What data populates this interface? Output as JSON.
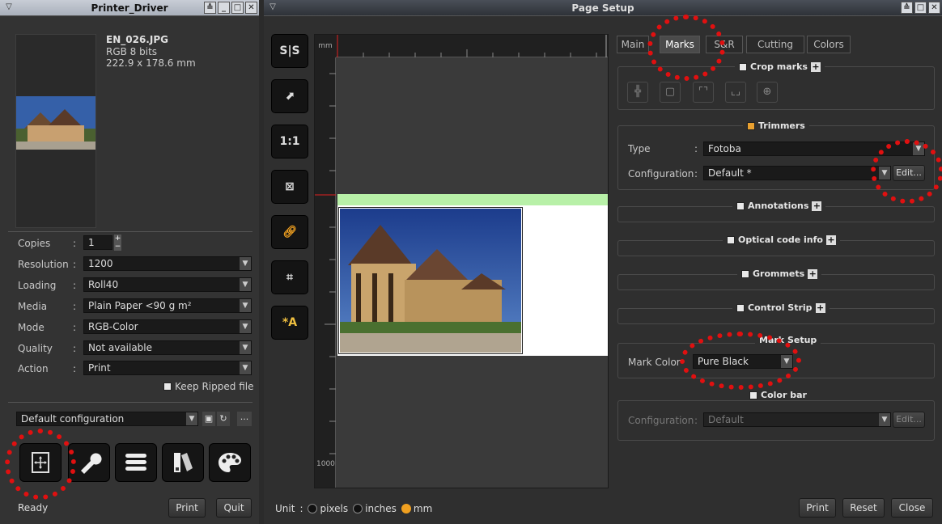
{
  "left_window": {
    "title": "Printer_Driver",
    "file": {
      "name": "EN_026.JPG",
      "mode": "RGB 8 bits",
      "size": "222.9 x 178.6 mm"
    },
    "fields": [
      {
        "label": "Copies",
        "value": "1"
      },
      {
        "label": "Resolution",
        "value": "1200"
      },
      {
        "label": "Loading",
        "value": "Roll40"
      },
      {
        "label": "Media",
        "value": "Plain Paper  <90 g m²"
      },
      {
        "label": "Mode",
        "value": "RGB-Color"
      },
      {
        "label": "Quality",
        "value": "Not available"
      },
      {
        "label": "Action",
        "value": "Print"
      }
    ],
    "keep_ripped": "Keep Ripped file",
    "configuration": "Default configuration",
    "status": "Ready",
    "print_label": "Print",
    "quit_label": "Quit",
    "tools": [
      "page-setup-icon",
      "wrench-icon",
      "list-icon",
      "swatch-icon",
      "palette-icon"
    ]
  },
  "right_window": {
    "title": "Page Setup",
    "ruler_unit": "mm",
    "ruler_end": "1000",
    "side_buttons": [
      "S|S",
      "↗",
      "1:1",
      "fit",
      "link",
      "center",
      "*A"
    ],
    "unit_label": "Unit",
    "units": [
      "pixels",
      "inches",
      "mm"
    ],
    "unit_selected": "mm",
    "tabs": [
      "Main",
      "Marks",
      "S&R",
      "Cutting",
      "Colors"
    ],
    "active_tab": "Marks",
    "crop_marks": "Crop marks",
    "trimmers": {
      "title": "Trimmers",
      "type_label": "Type",
      "type_value": "Fotoba",
      "config_label": "Configuration",
      "config_value": "Default *",
      "edit": "Edit..."
    },
    "annotations": "Annotations",
    "optical_code": "Optical code info",
    "grommets": "Grommets",
    "control_strip": "Control Strip",
    "mark_setup": {
      "title": "Mark Setup",
      "label": "Mark Color",
      "value": "Pure Black"
    },
    "color_bar": {
      "title": "Color bar",
      "config_label": "Configuration",
      "config_value": "Default",
      "edit": "Edit..."
    },
    "print_label": "Print",
    "reset_label": "Reset",
    "close_label": "Close"
  },
  "colors": {
    "highlight_circle": "#e01010",
    "accent": "#f0a020",
    "bleed_bar": "#b8f0a8"
  }
}
